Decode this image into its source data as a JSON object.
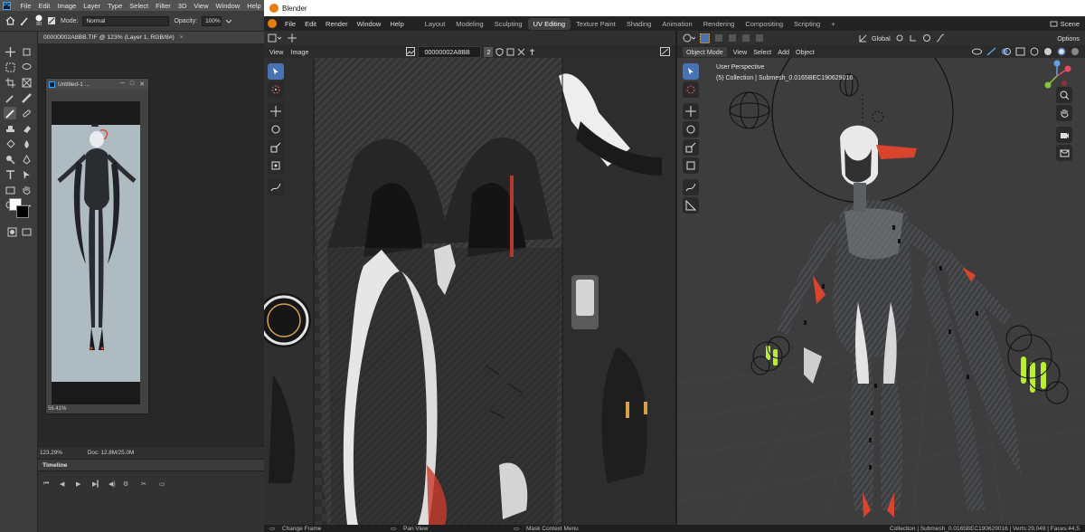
{
  "photoshop": {
    "logo": "Ps",
    "menu": [
      "File",
      "Edit",
      "Image",
      "Layer",
      "Type",
      "Select",
      "Filter",
      "3D",
      "View",
      "Window",
      "Help"
    ],
    "options": {
      "brush_size": "90",
      "mode_label": "Mode:",
      "mode_value": "Normal",
      "opacity_label": "Opacity:",
      "opacity_value": "100%"
    },
    "document_tab": "00000002A8BB.TIF @ 123% (Layer 1, RGB/8#)",
    "document_tab_close": "×",
    "floating_window": {
      "title": "Untitled-1 ...",
      "zoom": "56.41%"
    },
    "status": {
      "zoom": "123.29%",
      "doc": "Doc: 12.8M/25.0M"
    },
    "timeline_title": "Timeline"
  },
  "blender": {
    "window_title": "Blender",
    "menu": [
      "File",
      "Edit",
      "Render",
      "Window",
      "Help"
    ],
    "workspaces": [
      "Layout",
      "Modeling",
      "Sculpting",
      "UV Editing",
      "Texture Paint",
      "Shading",
      "Animation",
      "Rendering",
      "Compositing",
      "Scripting"
    ],
    "workspace_add": "+",
    "active_workspace": "UV Editing",
    "scene_label": "Scene",
    "uv_editor": {
      "view_menu": "View",
      "image_menu": "Image",
      "image_name": "00000002A8BB",
      "users": "2"
    },
    "viewport": {
      "mode": "Object Mode",
      "menus": [
        "View",
        "Select",
        "Add",
        "Object"
      ],
      "orientation": "Global",
      "options_label": "Options",
      "perspective": "User Perspective",
      "collection": "(5) Collection | Submesh_0.0165BEC190629016"
    },
    "status": {
      "change_frame": "Change Frame",
      "pan_view": "Pan View",
      "context_menu": "Mask Context Menu",
      "stats": "Collection | Submesh_0.0165BEC190629016 | Verts:29,049 | Faces:44,5"
    }
  },
  "colors": {
    "blender_active": "#4772b3",
    "blender_orange": "#e87d0d",
    "ps_blue": "#31a8ff",
    "accent_red": "#d9442f",
    "accent_green": "#b8f02a"
  }
}
